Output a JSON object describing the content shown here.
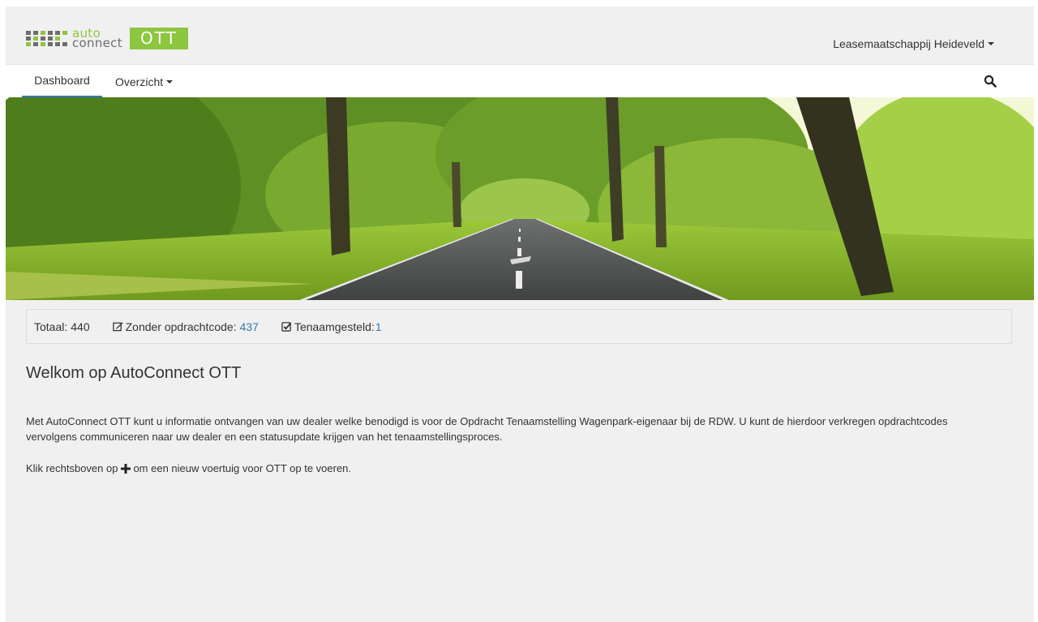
{
  "brand": {
    "logo_word_top": "auto",
    "logo_word_bottom": "connect",
    "product": "OTT",
    "colors": {
      "green": "#8dc63f",
      "gray": "#6d6d6d"
    }
  },
  "account": {
    "name": "Leasemaatschappij Heideveld",
    "icon": "chevron-down-icon"
  },
  "nav": {
    "items": [
      {
        "label": "Dashboard",
        "active": true
      },
      {
        "label": "Overzicht",
        "has_dropdown": true
      }
    ],
    "search_icon": "search-icon",
    "accent": "#337ab7"
  },
  "hero": {
    "description_icon": "tree-lined-road-banner"
  },
  "stats": {
    "total_label": "Totaal:",
    "total_value": "440",
    "without_code_label": "Zonder opdrachtcode:",
    "without_code_value": "437",
    "registered_label": "Tenaamgesteld:",
    "registered_value": "1",
    "link_color": "#337ab7"
  },
  "content": {
    "welcome_title": "Welkom op AutoConnect OTT",
    "intro": "Met AutoConnect OTT kunt u informatie ontvangen van uw dealer welke benodigd is voor de Opdracht Tenaamstelling Wagenpark-eigenaar bij de RDW. U kunt de hierdoor verkregen opdrachtcodes vervolgens communiceren naar uw dealer en een statusupdate krijgen van het tenaamstellingsproces.",
    "hint_before": "Klik rechtsboven op",
    "hint_after": "om een nieuw voertuig voor OTT op te voeren.",
    "hint_icon": "plus-icon"
  }
}
